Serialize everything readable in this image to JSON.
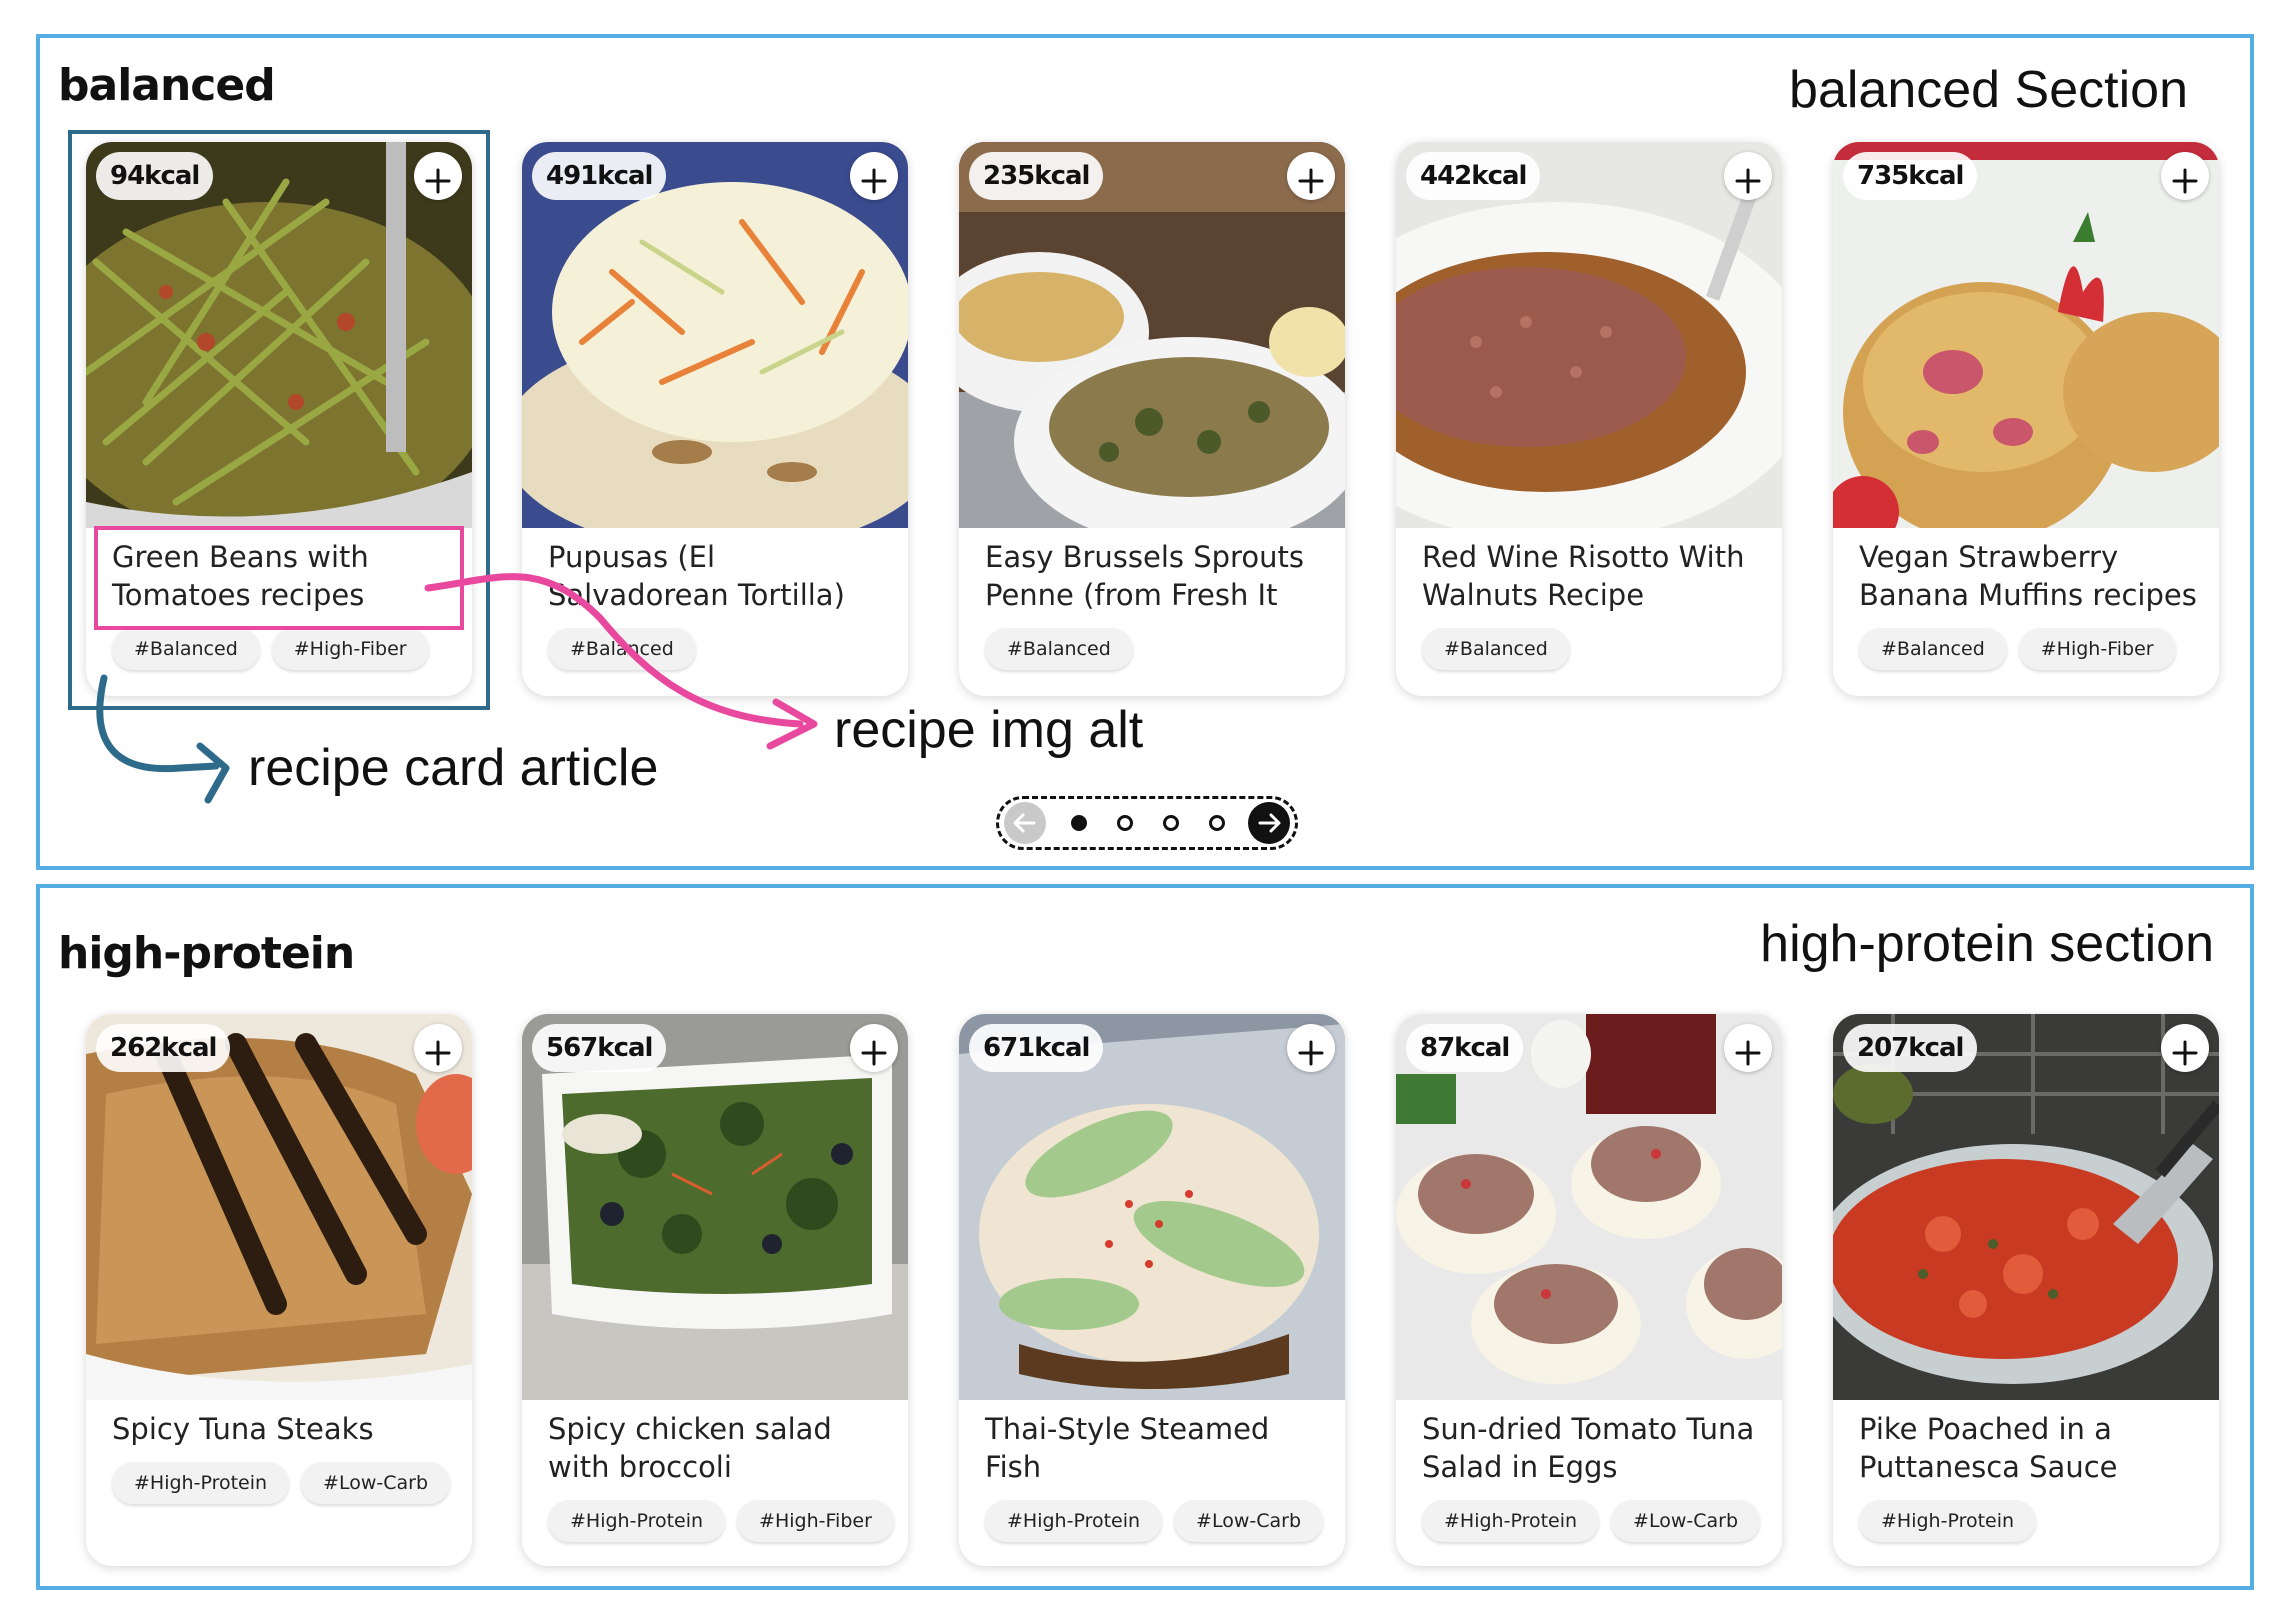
{
  "sections": [
    {
      "heading": "balanced",
      "annotation": "balanced Section",
      "cards": [
        {
          "kcal": "94kcal",
          "title": "Green Beans with Tomatoes recipes",
          "tags": [
            "#Balanced",
            "#High-Fiber"
          ]
        },
        {
          "kcal": "491kcal",
          "title": "Pupusas (El Salvadorean Tortilla)",
          "tags": [
            "#Balanced"
          ]
        },
        {
          "kcal": "235kcal",
          "title": "Easy Brussels Sprouts Penne (from Fresh It",
          "tags": [
            "#Balanced"
          ]
        },
        {
          "kcal": "442kcal",
          "title": "Red Wine Risotto With Walnuts Recipe",
          "tags": [
            "#Balanced"
          ]
        },
        {
          "kcal": "735kcal",
          "title": "Vegan Strawberry Banana Muffins recipes",
          "tags": [
            "#Balanced",
            "#High-Fiber"
          ]
        }
      ]
    },
    {
      "heading": "high-protein",
      "annotation": "high-protein section",
      "cards": [
        {
          "kcal": "262kcal",
          "title": "Spicy Tuna Steaks",
          "tags": [
            "#High-Protein",
            "#Low-Carb"
          ]
        },
        {
          "kcal": "567kcal",
          "title": "Spicy chicken salad with broccoli",
          "tags": [
            "#High-Protein",
            "#High-Fiber"
          ]
        },
        {
          "kcal": "671kcal",
          "title": "Thai-Style Steamed Fish",
          "tags": [
            "#High-Protein",
            "#Low-Carb"
          ]
        },
        {
          "kcal": "87kcal",
          "title": "Sun-dried Tomato Tuna Salad in Eggs",
          "tags": [
            "#High-Protein",
            "#Low-Carb"
          ]
        },
        {
          "kcal": "207kcal",
          "title": "Pike Poached in a Puttanesca Sauce",
          "tags": [
            "#High-Protein"
          ]
        }
      ]
    }
  ],
  "annotations": {
    "card_label": "recipe card article",
    "img_alt_label": "recipe img alt",
    "card_box_color": "#2e6b8a",
    "title_box_color": "#e8499e",
    "section_border_color": "#54aee3"
  },
  "pager": {
    "dots": 4,
    "active_index": 0,
    "prev_icon": "arrow-left-icon",
    "next_icon": "arrow-right-icon"
  },
  "icons": {
    "add": "plus-icon"
  }
}
